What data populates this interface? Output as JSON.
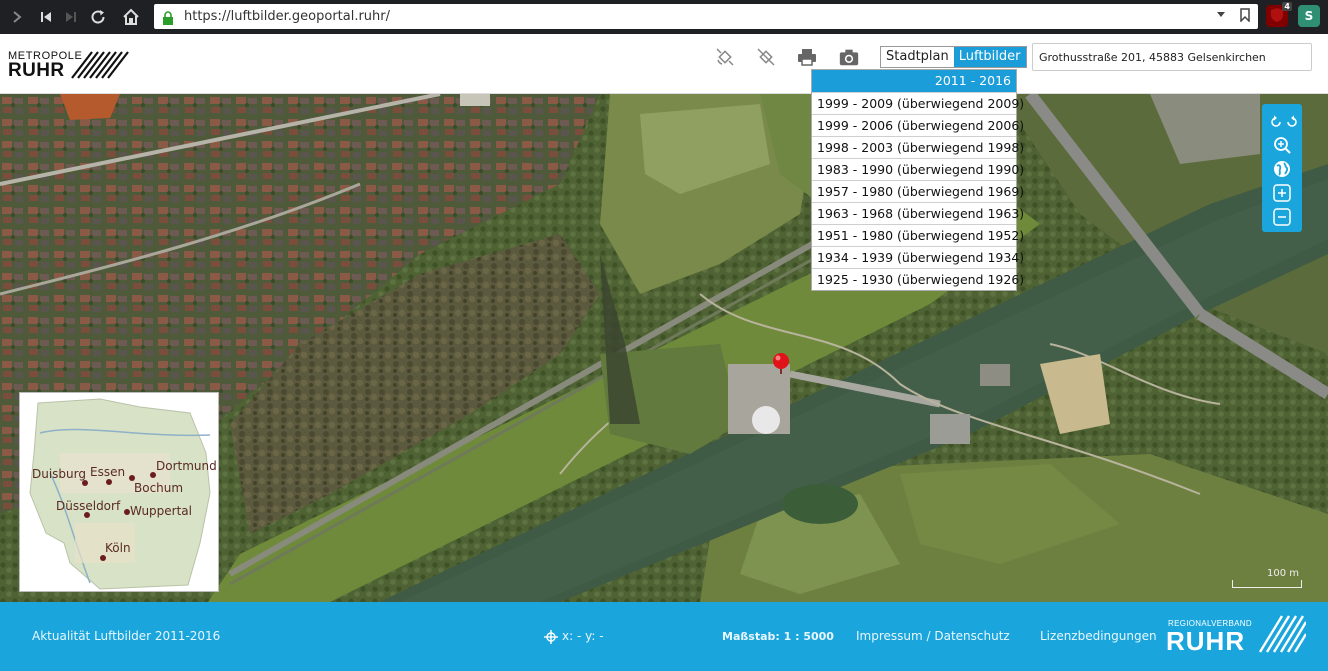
{
  "browser": {
    "url": "https://luftbilder.geoportal.ruhr/",
    "extension_badge": "4",
    "extension_s_label": "S"
  },
  "header": {
    "logo_line1": "METROPOLE",
    "logo_line2": "RUHR",
    "map_type_stadtplan": "Stadtplan",
    "map_type_luftbilder": "Luftbilder",
    "search_value": "Grothusstraße 201, 45883 Gelsenkirchen"
  },
  "dropdown": {
    "selected": "2011 - 2016",
    "items": [
      "1999 - 2009 (überwiegend 2009)",
      "1999 - 2006 (überwiegend 2006)",
      "1998 - 2003 (überwiegend 1998)",
      "1983 - 1990 (überwiegend 1990)",
      "1957 - 1980 (überwiegend 1969)",
      "1963 - 1968 (überwiegend 1963)",
      "1951 - 1980 (überwiegend 1952)",
      "1934 - 1939 (überwiegend 1934)",
      "1925 - 1930 (überwiegend 1926)"
    ]
  },
  "overview": {
    "cities": [
      "Duisburg",
      "Essen",
      "Dortmund",
      "Bochum",
      "Düsseldorf",
      "Wuppertal",
      "Köln"
    ]
  },
  "map": {
    "scale_label": "100 m"
  },
  "footer": {
    "actuality": "Aktualität Luftbilder 2011-2016",
    "coords": "x: - y: -",
    "scale": "Maßstab: 1 : 5000",
    "impressum": "Impressum / Datenschutz",
    "license": "Lizenzbedingungen",
    "logo_line1": "REGIONALVERBAND",
    "logo_line2": "RUHR"
  },
  "colors": {
    "accent": "#1aa6dd",
    "selected": "#1a9dd9",
    "marker": "#e0131b"
  }
}
